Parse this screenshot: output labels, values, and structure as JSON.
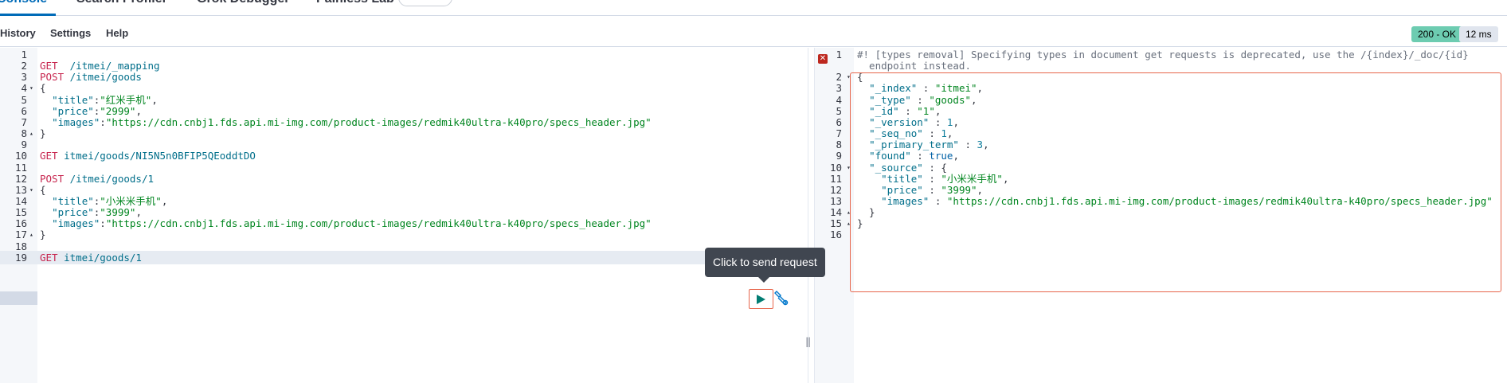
{
  "top_tabs": [
    "Console",
    "Search Profiler",
    "Grok Debugger",
    "Painless Lab"
  ],
  "menu": [
    "History",
    "Settings",
    "Help"
  ],
  "status": {
    "code_text": "200 - OK",
    "time_text": "12 ms"
  },
  "tooltip": "Click to send request",
  "colors": {
    "accent": "#006bb8",
    "status_ok": "#6dccb1",
    "error": "#bd271e",
    "highlight": "#e7664c"
  },
  "request_lines": [
    "",
    "GET  /itmei/_mapping",
    "POST /itmei/goods",
    "{",
    "  \"title\":\"红米手机\",",
    "  \"price\":\"2999\",",
    "  \"images\":\"https://cdn.cnbj1.fds.api.mi-img.com/product-images/redmik40ultra-k40pro/specs_header.jpg\"",
    "}",
    "",
    "GET itmei/goods/NI5N5n0BFIP5QEoddtDO",
    "",
    "POST /itmei/goods/1",
    "{",
    "  \"title\":\"小米米手机\",",
    "  \"price\":\"3999\",",
    "  \"images\":\"https://cdn.cnbj1.fds.api.mi-img.com/product-images/redmik40ultra-k40pro/specs_header.jpg\"",
    "}",
    "",
    "GET itmei/goods/1"
  ],
  "response_lines": [
    "#! [types removal] Specifying types in document get requests is deprecated, use the /{index}/_doc/{id}",
    "  endpoint instead.",
    "{",
    "  \"_index\" : \"itmei\",",
    "  \"_type\" : \"goods\",",
    "  \"_id\" : \"1\",",
    "  \"_version\" : 1,",
    "  \"_seq_no\" : 1,",
    "  \"_primary_term\" : 3,",
    "  \"found\" : true,",
    "  \"_source\" : {",
    "    \"title\" : \"小米米手机\",",
    "    \"price\" : \"3999\",",
    "    \"images\" : \"https://cdn.cnbj1.fds.api.mi-img.com/product-images/redmik40ultra-k40pro/specs_header.jpg\"",
    "  }",
    "}",
    ""
  ]
}
